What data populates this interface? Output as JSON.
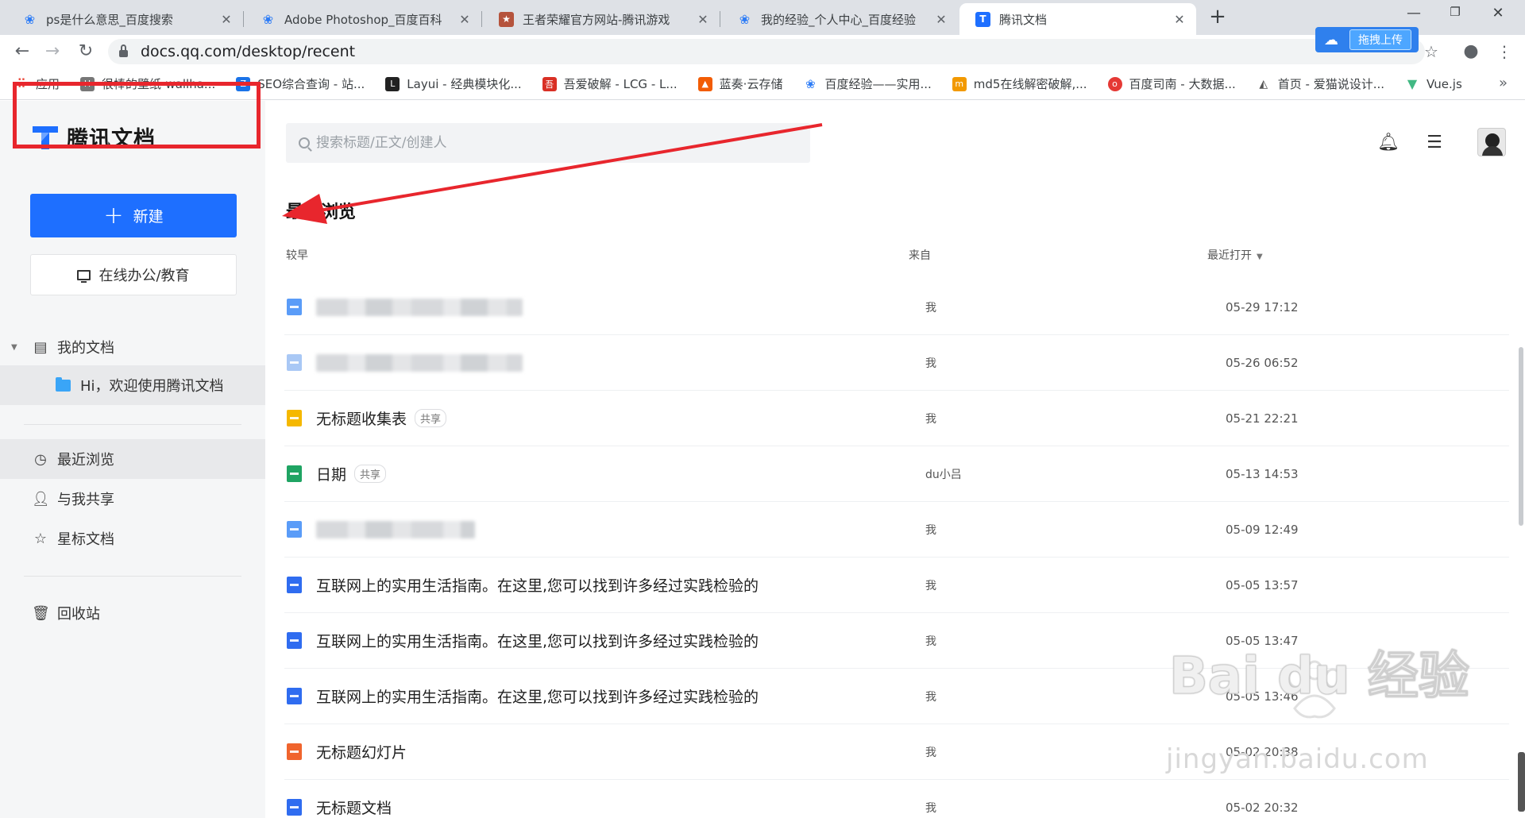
{
  "browser": {
    "tabs": [
      {
        "title": "ps是什么意思_百度搜索",
        "icon": "baidu-paw-icon",
        "color": "#2d7cf6"
      },
      {
        "title": "Adobe Photoshop_百度百科",
        "icon": "baidu-paw-icon",
        "color": "#2d7cf6"
      },
      {
        "title": "王者荣耀官方网站-腾讯游戏",
        "icon": "game-icon",
        "color": "#b5533c"
      },
      {
        "title": "我的经验_个人中心_百度经验",
        "icon": "baidu-paw-icon",
        "color": "#2d7cf6"
      },
      {
        "title": "腾讯文档",
        "icon": "tencent-docs-icon",
        "color": "#1e6fff"
      }
    ],
    "url": "docs.qq.com/desktop/recent",
    "extension_label": "拖拽上传",
    "bookmarks": [
      {
        "label": "应用",
        "color": "#ea4335"
      },
      {
        "label": "很棒的壁纸-wallha...",
        "color": "#777777"
      },
      {
        "label": "SEO综合查询 - 站...",
        "color": "#1a73e8"
      },
      {
        "label": "Layui - 经典模块化...",
        "color": "#222222"
      },
      {
        "label": "吾爱破解 - LCG - L...",
        "color": "#d93025"
      },
      {
        "label": "蓝奏·云存储",
        "color": "#f25c05"
      },
      {
        "label": "百度经验——实用...",
        "color": "#2d7cf6"
      },
      {
        "label": "md5在线解密破解,...",
        "color": "#f29900"
      },
      {
        "label": "百度司南 - 大数据...",
        "color": "#e53935"
      },
      {
        "label": "首页 - 爱猫说设计...",
        "color": "#555555"
      },
      {
        "label": "Vue.js",
        "color": "#41b883"
      }
    ]
  },
  "app": {
    "brand": "腾讯文档",
    "new_button": "新建",
    "edu_button": "在线办公/教育",
    "search_placeholder": "搜索标题/正文/创建人",
    "sidebar": {
      "my_docs": "我的文档",
      "welcome_folder": "Hi，欢迎使用腾讯文档",
      "recent": "最近浏览",
      "shared": "与我共享",
      "starred": "星标文档",
      "trash": "回收站"
    },
    "section_title": "最近浏览",
    "columns": {
      "earlier": "较早",
      "from": "来自",
      "last_opened": "最近打开"
    },
    "files": [
      {
        "name": "",
        "blurred": true,
        "tag": "",
        "from": "我",
        "time": "05-29 17:12",
        "icon_color": "#5a9cf8"
      },
      {
        "name": "",
        "blurred": true,
        "tag": "",
        "from": "我",
        "time": "05-26 06:52",
        "icon_color": "#a9c8f5"
      },
      {
        "name": "无标题收集表",
        "blurred": false,
        "tag": "共享",
        "from": "我",
        "time": "05-21 22:21",
        "icon_color": "#f5b800"
      },
      {
        "name": "日期",
        "blurred": false,
        "tag": "共享",
        "from": "du小吕",
        "time": "05-13 14:53",
        "icon_color": "#1fa463"
      },
      {
        "name": "",
        "blurred": true,
        "tag": "",
        "from": "我",
        "time": "05-09 12:49",
        "icon_color": "#5a9cf8"
      },
      {
        "name": "互联网上的实用生活指南。在这里,您可以找到许多经过实践检验的",
        "blurred": false,
        "tag": "",
        "from": "我",
        "time": "05-05 13:57",
        "icon_color": "#2f6cf0"
      },
      {
        "name": "互联网上的实用生活指南。在这里,您可以找到许多经过实践检验的",
        "blurred": false,
        "tag": "",
        "from": "我",
        "time": "05-05 13:47",
        "icon_color": "#2f6cf0"
      },
      {
        "name": "互联网上的实用生活指南。在这里,您可以找到许多经过实践检验的",
        "blurred": false,
        "tag": "",
        "from": "我",
        "time": "05-05 13:46",
        "icon_color": "#2f6cf0"
      },
      {
        "name": "无标题幻灯片",
        "blurred": false,
        "tag": "",
        "from": "我",
        "time": "05-02 20:38",
        "icon_color": "#f0642d"
      },
      {
        "name": "无标题文档",
        "blurred": false,
        "tag": "",
        "from": "我",
        "time": "05-02 20:32",
        "icon_color": "#2f6cf0"
      }
    ]
  },
  "watermark": {
    "main": "Bai du 经验",
    "sub": "jingyan.baidu.com"
  },
  "annotation_color": "#e8262d"
}
